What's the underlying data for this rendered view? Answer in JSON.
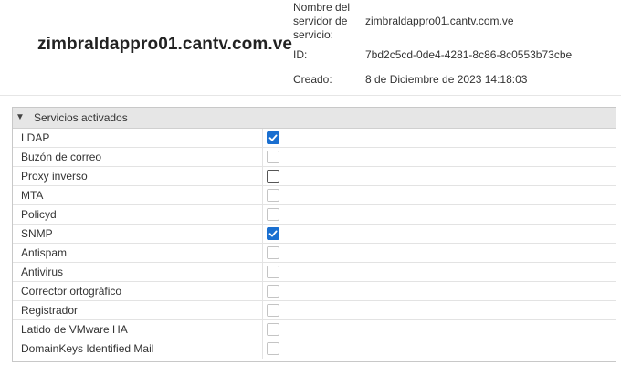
{
  "server": {
    "name": "zimbraldappro01.cantv.com.ve",
    "service_name_label_lines": [
      "Nombre del",
      "servidor de",
      "servicio:"
    ],
    "service_name_value": "zimbraldappro01.cantv.com.ve",
    "id_label": "ID:",
    "id_value": "7bd2c5cd-0de4-4281-8c86-8c0553b73cbe",
    "created_label": "Creado:",
    "created_value": "8 de Diciembre de 2023 14:18:03"
  },
  "services": {
    "title": "Servicios activados",
    "expanded": true,
    "accent_color": "#1a6fd0",
    "items": [
      {
        "label": "LDAP",
        "checked": true,
        "enabled": true
      },
      {
        "label": "Buzón de correo",
        "checked": false,
        "enabled": false
      },
      {
        "label": "Proxy inverso",
        "checked": false,
        "enabled": true
      },
      {
        "label": "MTA",
        "checked": false,
        "enabled": false
      },
      {
        "label": "Policyd",
        "checked": false,
        "enabled": false
      },
      {
        "label": "SNMP",
        "checked": true,
        "enabled": true
      },
      {
        "label": "Antispam",
        "checked": false,
        "enabled": false
      },
      {
        "label": "Antivirus",
        "checked": false,
        "enabled": false
      },
      {
        "label": "Corrector ortográfico",
        "checked": false,
        "enabled": false
      },
      {
        "label": "Registrador",
        "checked": false,
        "enabled": false
      },
      {
        "label": "Latido de VMware HA",
        "checked": false,
        "enabled": false
      },
      {
        "label": "DomainKeys Identified Mail",
        "checked": false,
        "enabled": false
      }
    ]
  }
}
